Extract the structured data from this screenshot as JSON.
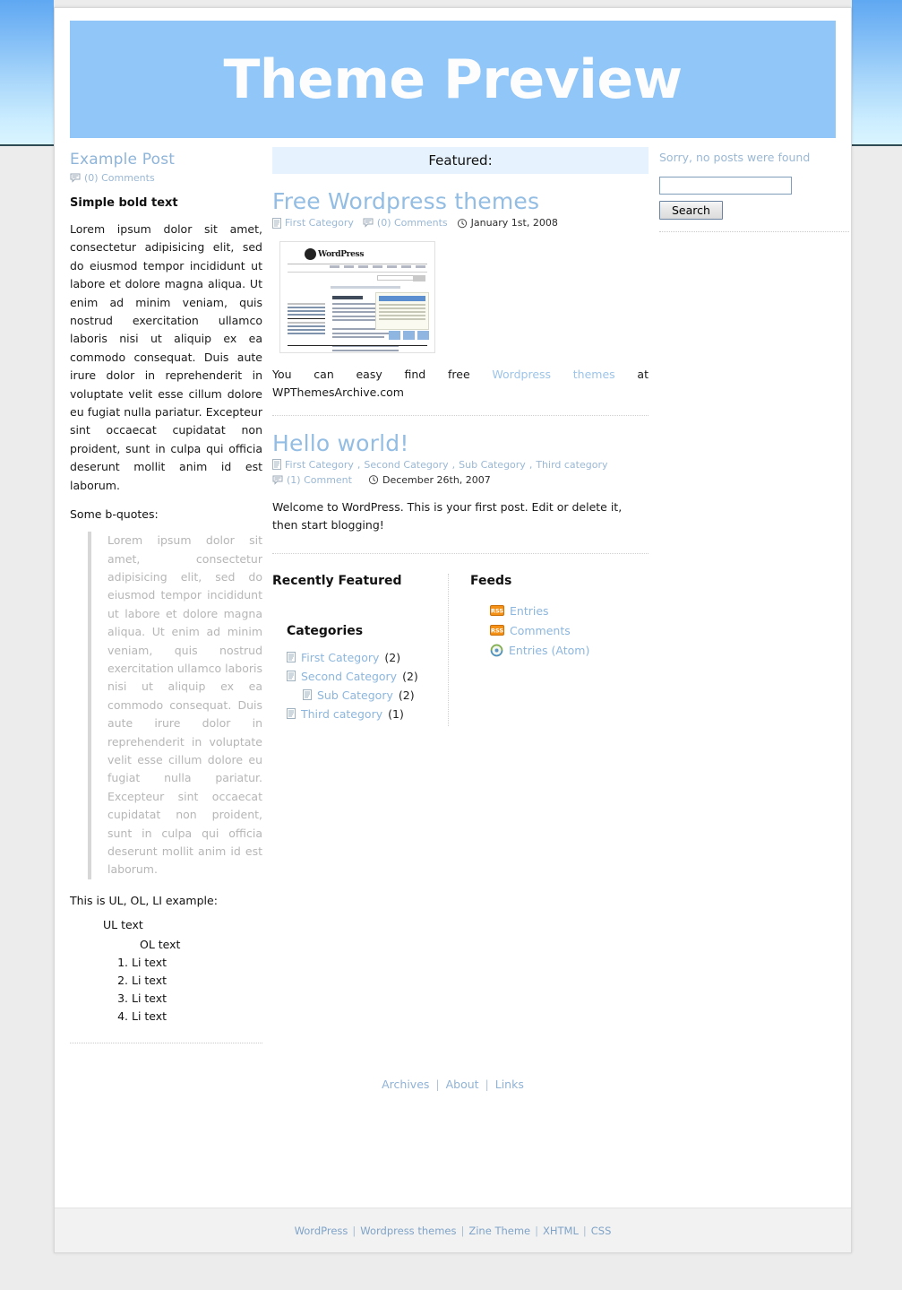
{
  "header": {
    "title": "Theme Preview"
  },
  "left_column": {
    "post_title": "Example Post",
    "comments_label": "(0) Comments",
    "bold_heading": "Simple bold text",
    "paragraph": "Lorem ipsum dolor sit amet, consectetur adipisicing elit, sed do eiusmod tempor incididunt ut labore et dolore magna aliqua. Ut enim ad minim veniam, quis nostrud exercitation ullamco laboris nisi ut aliquip ex ea commodo consequat. Duis aute irure dolor in reprehenderit in voluptate velit esse cillum dolore eu fugiat nulla pariatur. Excepteur sint occaecat cupidatat non proident, sunt in culpa qui officia deserunt mollit anim id est laborum.",
    "blockquote_intro": "Some b-quotes:",
    "blockquote_text": "Lorem ipsum dolor sit amet, consectetur adipisicing elit, sed do eiusmod tempor incididunt ut labore et dolore magna aliqua. Ut enim ad minim veniam, quis nostrud exercitation ullamco laboris nisi ut aliquip ex ea commodo consequat. Duis aute irure dolor in reprehenderit in voluptate velit esse cillum dolore eu fugiat nulla pariatur. Excepteur sint occaecat cupidatat non proident, sunt in culpa qui officia deserunt mollit anim id est laborum.",
    "list_intro": "This is UL, OL, LI example:",
    "ul_text": "UL text",
    "ol_text": "OL text",
    "li_items": [
      "Li text",
      "Li text",
      "Li text",
      "Li text"
    ]
  },
  "center_column": {
    "featured_bar_label": "Featured:",
    "posts": [
      {
        "title": "Free Wordpress themes",
        "category": "First Category",
        "comments": "(0) Comments",
        "date": "January 1st, 2008",
        "body_before": "You can easy find free ",
        "body_link": "Wordpress themes",
        "body_after": " at WPThemesArchive.com"
      },
      {
        "title": "Hello world!",
        "categories": [
          "First Category",
          "Second Category",
          "Sub Category",
          "Third category"
        ],
        "comments": "(1) Comment",
        "date": "December 26th, 2007",
        "body": "Welcome to WordPress. This is your first post. Edit or delete it, then start blogging!"
      }
    ],
    "recently_featured_heading": "Recently Featured",
    "categories_heading": "Categories",
    "categories": [
      {
        "label": "First Category",
        "count": "(2)",
        "sub": false
      },
      {
        "label": "Second Category",
        "count": "(2)",
        "sub": false
      },
      {
        "label": "Sub Category",
        "count": "(2)",
        "sub": true
      },
      {
        "label": "Third category",
        "count": "(1)",
        "sub": false
      }
    ],
    "feeds_heading": "Feeds",
    "feeds": [
      {
        "label": "Entries",
        "icon": "rss-icon"
      },
      {
        "label": "Comments",
        "icon": "rss-icon"
      },
      {
        "label": "Entries (Atom)",
        "icon": "atom-icon"
      }
    ]
  },
  "right_column": {
    "no_posts_message": "Sorry, no posts were found",
    "search_value": "",
    "search_placeholder": "",
    "search_button_label": "Search"
  },
  "footer_nav": {
    "links": [
      "Archives",
      "About",
      "Links"
    ],
    "separator": "|"
  },
  "credits": {
    "links": [
      "WordPress",
      "Wordpress themes",
      "Zine Theme",
      "XHTML",
      "CSS"
    ],
    "separator": "|"
  },
  "thumbnail": {
    "alt": "WordPress homepage screenshot",
    "logo_text": "WordPress"
  },
  "colors": {
    "banner_bg": "#91c6f9",
    "banner_text": "#fdfdfd",
    "link_blue": "#8cb6dd",
    "featured_bar": "#e6f2fd",
    "rss_orange": "#f59016"
  }
}
